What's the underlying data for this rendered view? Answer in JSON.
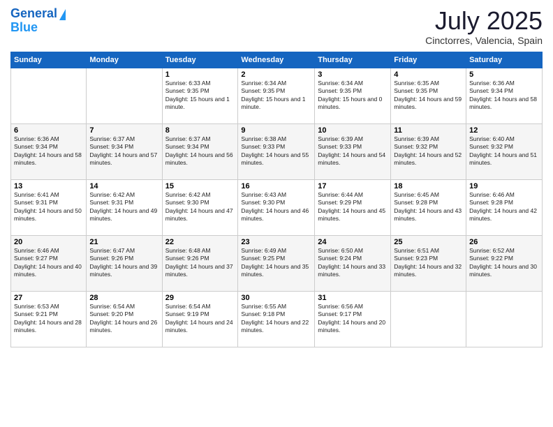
{
  "logo": {
    "line1": "General",
    "line2": "Blue"
  },
  "title": "July 2025",
  "subtitle": "Cinctorres, Valencia, Spain",
  "weekdays": [
    "Sunday",
    "Monday",
    "Tuesday",
    "Wednesday",
    "Thursday",
    "Friday",
    "Saturday"
  ],
  "weeks": [
    [
      {
        "day": "",
        "sunrise": "",
        "sunset": "",
        "daylight": ""
      },
      {
        "day": "",
        "sunrise": "",
        "sunset": "",
        "daylight": ""
      },
      {
        "day": "1",
        "sunrise": "Sunrise: 6:33 AM",
        "sunset": "Sunset: 9:35 PM",
        "daylight": "Daylight: 15 hours and 1 minute."
      },
      {
        "day": "2",
        "sunrise": "Sunrise: 6:34 AM",
        "sunset": "Sunset: 9:35 PM",
        "daylight": "Daylight: 15 hours and 1 minute."
      },
      {
        "day": "3",
        "sunrise": "Sunrise: 6:34 AM",
        "sunset": "Sunset: 9:35 PM",
        "daylight": "Daylight: 15 hours and 0 minutes."
      },
      {
        "day": "4",
        "sunrise": "Sunrise: 6:35 AM",
        "sunset": "Sunset: 9:35 PM",
        "daylight": "Daylight: 14 hours and 59 minutes."
      },
      {
        "day": "5",
        "sunrise": "Sunrise: 6:36 AM",
        "sunset": "Sunset: 9:34 PM",
        "daylight": "Daylight: 14 hours and 58 minutes."
      }
    ],
    [
      {
        "day": "6",
        "sunrise": "Sunrise: 6:36 AM",
        "sunset": "Sunset: 9:34 PM",
        "daylight": "Daylight: 14 hours and 58 minutes."
      },
      {
        "day": "7",
        "sunrise": "Sunrise: 6:37 AM",
        "sunset": "Sunset: 9:34 PM",
        "daylight": "Daylight: 14 hours and 57 minutes."
      },
      {
        "day": "8",
        "sunrise": "Sunrise: 6:37 AM",
        "sunset": "Sunset: 9:34 PM",
        "daylight": "Daylight: 14 hours and 56 minutes."
      },
      {
        "day": "9",
        "sunrise": "Sunrise: 6:38 AM",
        "sunset": "Sunset: 9:33 PM",
        "daylight": "Daylight: 14 hours and 55 minutes."
      },
      {
        "day": "10",
        "sunrise": "Sunrise: 6:39 AM",
        "sunset": "Sunset: 9:33 PM",
        "daylight": "Daylight: 14 hours and 54 minutes."
      },
      {
        "day": "11",
        "sunrise": "Sunrise: 6:39 AM",
        "sunset": "Sunset: 9:32 PM",
        "daylight": "Daylight: 14 hours and 52 minutes."
      },
      {
        "day": "12",
        "sunrise": "Sunrise: 6:40 AM",
        "sunset": "Sunset: 9:32 PM",
        "daylight": "Daylight: 14 hours and 51 minutes."
      }
    ],
    [
      {
        "day": "13",
        "sunrise": "Sunrise: 6:41 AM",
        "sunset": "Sunset: 9:31 PM",
        "daylight": "Daylight: 14 hours and 50 minutes."
      },
      {
        "day": "14",
        "sunrise": "Sunrise: 6:42 AM",
        "sunset": "Sunset: 9:31 PM",
        "daylight": "Daylight: 14 hours and 49 minutes."
      },
      {
        "day": "15",
        "sunrise": "Sunrise: 6:42 AM",
        "sunset": "Sunset: 9:30 PM",
        "daylight": "Daylight: 14 hours and 47 minutes."
      },
      {
        "day": "16",
        "sunrise": "Sunrise: 6:43 AM",
        "sunset": "Sunset: 9:30 PM",
        "daylight": "Daylight: 14 hours and 46 minutes."
      },
      {
        "day": "17",
        "sunrise": "Sunrise: 6:44 AM",
        "sunset": "Sunset: 9:29 PM",
        "daylight": "Daylight: 14 hours and 45 minutes."
      },
      {
        "day": "18",
        "sunrise": "Sunrise: 6:45 AM",
        "sunset": "Sunset: 9:28 PM",
        "daylight": "Daylight: 14 hours and 43 minutes."
      },
      {
        "day": "19",
        "sunrise": "Sunrise: 6:46 AM",
        "sunset": "Sunset: 9:28 PM",
        "daylight": "Daylight: 14 hours and 42 minutes."
      }
    ],
    [
      {
        "day": "20",
        "sunrise": "Sunrise: 6:46 AM",
        "sunset": "Sunset: 9:27 PM",
        "daylight": "Daylight: 14 hours and 40 minutes."
      },
      {
        "day": "21",
        "sunrise": "Sunrise: 6:47 AM",
        "sunset": "Sunset: 9:26 PM",
        "daylight": "Daylight: 14 hours and 39 minutes."
      },
      {
        "day": "22",
        "sunrise": "Sunrise: 6:48 AM",
        "sunset": "Sunset: 9:26 PM",
        "daylight": "Daylight: 14 hours and 37 minutes."
      },
      {
        "day": "23",
        "sunrise": "Sunrise: 6:49 AM",
        "sunset": "Sunset: 9:25 PM",
        "daylight": "Daylight: 14 hours and 35 minutes."
      },
      {
        "day": "24",
        "sunrise": "Sunrise: 6:50 AM",
        "sunset": "Sunset: 9:24 PM",
        "daylight": "Daylight: 14 hours and 33 minutes."
      },
      {
        "day": "25",
        "sunrise": "Sunrise: 6:51 AM",
        "sunset": "Sunset: 9:23 PM",
        "daylight": "Daylight: 14 hours and 32 minutes."
      },
      {
        "day": "26",
        "sunrise": "Sunrise: 6:52 AM",
        "sunset": "Sunset: 9:22 PM",
        "daylight": "Daylight: 14 hours and 30 minutes."
      }
    ],
    [
      {
        "day": "27",
        "sunrise": "Sunrise: 6:53 AM",
        "sunset": "Sunset: 9:21 PM",
        "daylight": "Daylight: 14 hours and 28 minutes."
      },
      {
        "day": "28",
        "sunrise": "Sunrise: 6:54 AM",
        "sunset": "Sunset: 9:20 PM",
        "daylight": "Daylight: 14 hours and 26 minutes."
      },
      {
        "day": "29",
        "sunrise": "Sunrise: 6:54 AM",
        "sunset": "Sunset: 9:19 PM",
        "daylight": "Daylight: 14 hours and 24 minutes."
      },
      {
        "day": "30",
        "sunrise": "Sunrise: 6:55 AM",
        "sunset": "Sunset: 9:18 PM",
        "daylight": "Daylight: 14 hours and 22 minutes."
      },
      {
        "day": "31",
        "sunrise": "Sunrise: 6:56 AM",
        "sunset": "Sunset: 9:17 PM",
        "daylight": "Daylight: 14 hours and 20 minutes."
      },
      {
        "day": "",
        "sunrise": "",
        "sunset": "",
        "daylight": ""
      },
      {
        "day": "",
        "sunrise": "",
        "sunset": "",
        "daylight": ""
      }
    ]
  ]
}
